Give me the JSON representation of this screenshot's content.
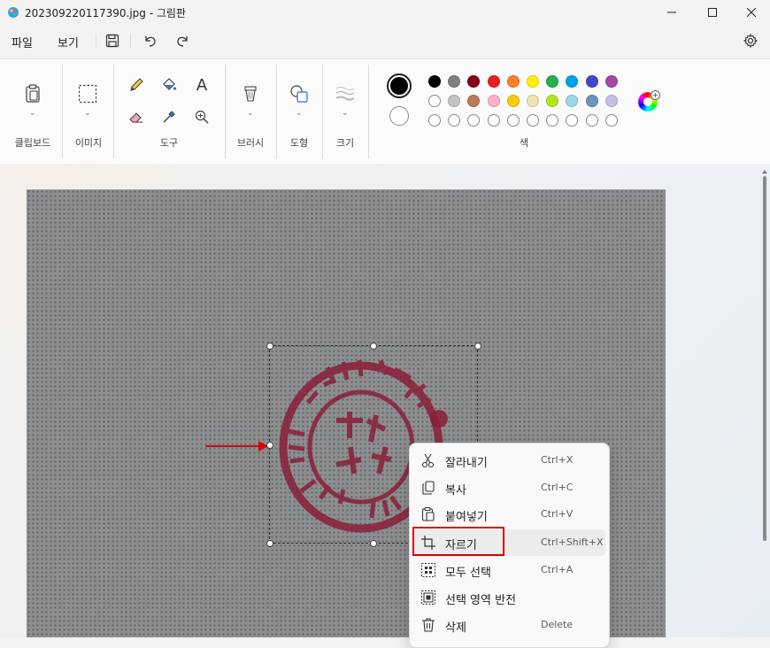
{
  "window": {
    "title": "202309220117390.jpg - 그림판"
  },
  "menu": {
    "file": "파일",
    "view": "보기"
  },
  "ribbon": {
    "groups": {
      "clipboard": "클립보드",
      "image": "이미지",
      "tools": "도구",
      "brushes": "브러시",
      "shapes": "도형",
      "size": "크기",
      "colors": "색"
    },
    "text_tool": "A"
  },
  "colors": {
    "primary": "#000000",
    "secondary": "#ffffff",
    "row1": [
      "#000000",
      "#7f7f7f",
      "#880015",
      "#ed1c24",
      "#ff7f27",
      "#fff200",
      "#22b14c",
      "#00a2e8",
      "#3f48cc",
      "#a349a4"
    ],
    "row2": [
      "#ffffff",
      "#c3c3c3",
      "#b97a57",
      "#ffaec9",
      "#ffc90e",
      "#efe4b0",
      "#b5e61d",
      "#99d9ea",
      "#7092be",
      "#c8bfe7"
    ],
    "row3": [
      "#ffffff",
      "#ffffff",
      "#ffffff",
      "#ffffff",
      "#ffffff",
      "#ffffff",
      "#ffffff",
      "#ffffff",
      "#ffffff",
      "#ffffff"
    ]
  },
  "context_menu": {
    "items": [
      {
        "label": "잘라내기",
        "shortcut": "Ctrl+X",
        "icon": "scissors-icon"
      },
      {
        "label": "복사",
        "shortcut": "Ctrl+C",
        "icon": "copy-icon"
      },
      {
        "label": "붙여넣기",
        "shortcut": "Ctrl+V",
        "icon": "paste-icon"
      },
      {
        "label": "자르기",
        "shortcut": "Ctrl+Shift+X",
        "icon": "crop-icon"
      },
      {
        "label": "모두 선택",
        "shortcut": "Ctrl+A",
        "icon": "select-all-icon"
      },
      {
        "label": "선택 영역 반전",
        "shortcut": "",
        "icon": "invert-selection-icon"
      },
      {
        "label": "삭제",
        "shortcut": "Delete",
        "icon": "trash-icon"
      }
    ]
  },
  "annotations": {
    "highlight_color": "#e00000"
  }
}
